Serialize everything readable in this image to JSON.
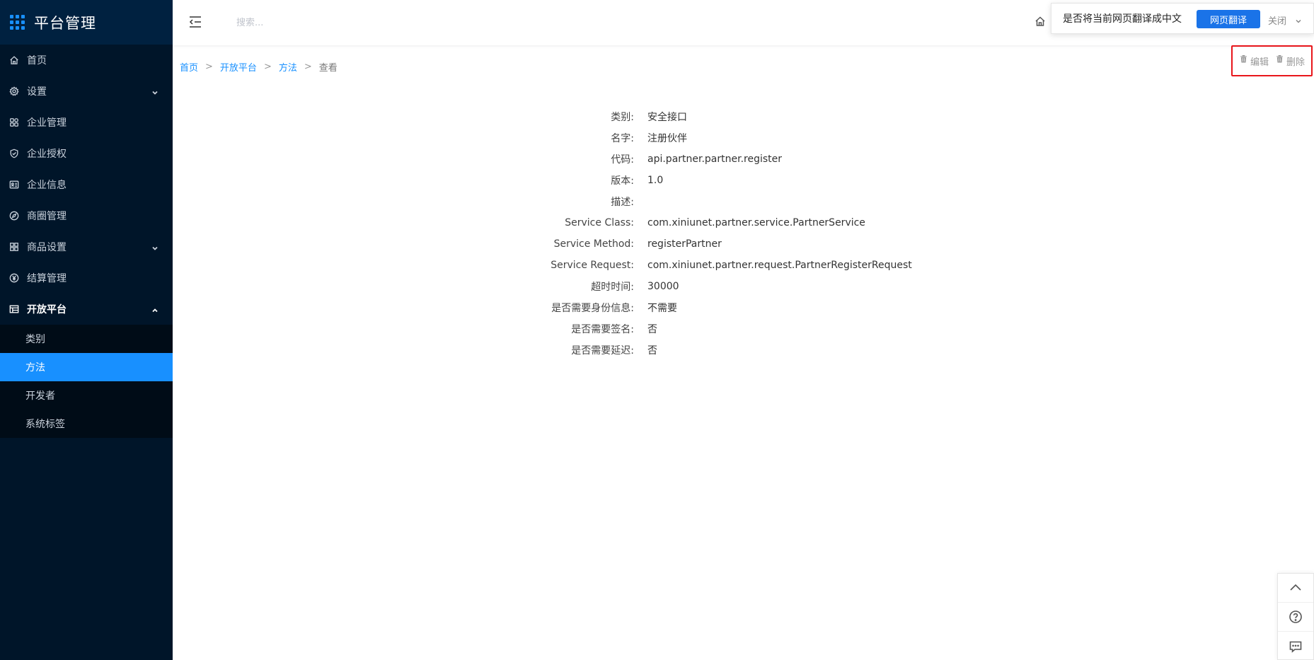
{
  "brand": {
    "title": "平台管理"
  },
  "sidebar": {
    "items": [
      {
        "label": "首页",
        "icon": "home-icon"
      },
      {
        "label": "设置",
        "icon": "gear-icon",
        "expandable": true
      },
      {
        "label": "企业管理",
        "icon": "apps-icon"
      },
      {
        "label": "企业授权",
        "icon": "shield-icon"
      },
      {
        "label": "企业信息",
        "icon": "profile-icon"
      },
      {
        "label": "商圈管理",
        "icon": "compass-icon"
      },
      {
        "label": "商品设置",
        "icon": "grid-icon",
        "expandable": true
      },
      {
        "label": "结算管理",
        "icon": "yen-icon"
      },
      {
        "label": "开放平台",
        "icon": "table-icon",
        "expandable": true,
        "open": true
      }
    ],
    "submenu": [
      {
        "label": "类别"
      },
      {
        "label": "方法",
        "active": true
      },
      {
        "label": "开发者"
      },
      {
        "label": "系统标签"
      }
    ]
  },
  "header": {
    "search_placeholder": "搜索..."
  },
  "translate": {
    "question": "是否将当前网页翻译成中文",
    "button": "网页翻译",
    "close": "关闭"
  },
  "breadcrumb": {
    "items": [
      "首页",
      "开放平台",
      "方法"
    ],
    "current": "查看",
    "separator": ">"
  },
  "actions": {
    "edit": "编辑",
    "delete": "删除",
    "highlight_color": "#e8161b"
  },
  "details": [
    {
      "label": "类别:",
      "value": "安全接口"
    },
    {
      "label": "名字:",
      "value": "注册伙伴"
    },
    {
      "label": "代码:",
      "value": "api.partner.partner.register"
    },
    {
      "label": "版本:",
      "value": "1.0"
    },
    {
      "label": "描述:",
      "value": ""
    },
    {
      "label": "Service Class:",
      "value": "com.xiniunet.partner.service.PartnerService"
    },
    {
      "label": "Service Method:",
      "value": "registerPartner"
    },
    {
      "label": "Service Request:",
      "value": "com.xiniunet.partner.request.PartnerRegisterRequest"
    },
    {
      "label": "超时时间:",
      "value": "30000"
    },
    {
      "label": "是否需要身份信息:",
      "value": "不需要"
    },
    {
      "label": "是否需要签名:",
      "value": "否"
    },
    {
      "label": "是否需要延迟:",
      "value": "否"
    }
  ],
  "colors": {
    "sidebar_bg": "#001529",
    "accent": "#1890ff",
    "translate_btn": "#1a73e8"
  }
}
